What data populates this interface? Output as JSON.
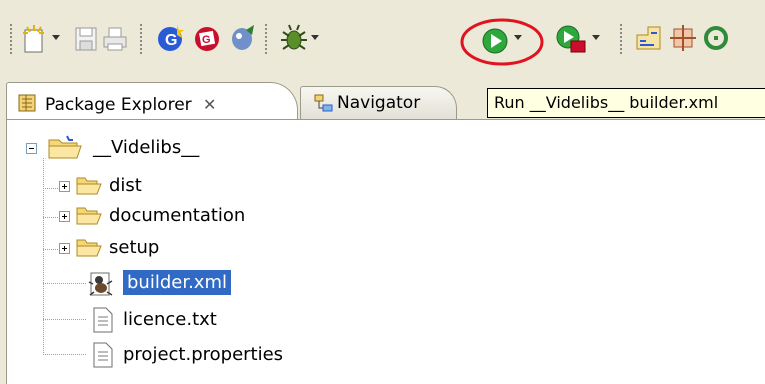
{
  "toolbar": {
    "icons": [
      "new-icon",
      "save-icon",
      "print-icon",
      "new-java-project-icon",
      "testng-icon",
      "debug-tools-icon",
      "debug-icon",
      "run-icon",
      "external-tools-icon",
      "open-type-icon",
      "open-task-icon",
      "search-icon"
    ],
    "highlight_color": "#e0141e"
  },
  "tabs": [
    {
      "label": "Package Explorer",
      "active": true,
      "icon": "package-explorer-icon",
      "close_glyph": "✕"
    },
    {
      "label": "Navigator",
      "active": false,
      "icon": "navigator-icon"
    }
  ],
  "tooltip": {
    "text": "Run __Videlibs__ builder.xml"
  },
  "tree": {
    "root": {
      "label": "__Videlibs__",
      "expanded": true,
      "icon": "project-folder-icon"
    },
    "children": [
      {
        "label": "dist",
        "type": "folder",
        "expanded": false
      },
      {
        "label": "documentation",
        "type": "folder",
        "expanded": false
      },
      {
        "label": "setup",
        "type": "folder",
        "expanded": false
      },
      {
        "label": "builder.xml",
        "type": "ant-file",
        "selected": true
      },
      {
        "label": "licence.txt",
        "type": "file"
      },
      {
        "label": "project.properties",
        "type": "file"
      }
    ]
  },
  "colors": {
    "selection": "#316ac5",
    "folder": "#f5d778",
    "toolbar_bg": "#ece9d8"
  }
}
